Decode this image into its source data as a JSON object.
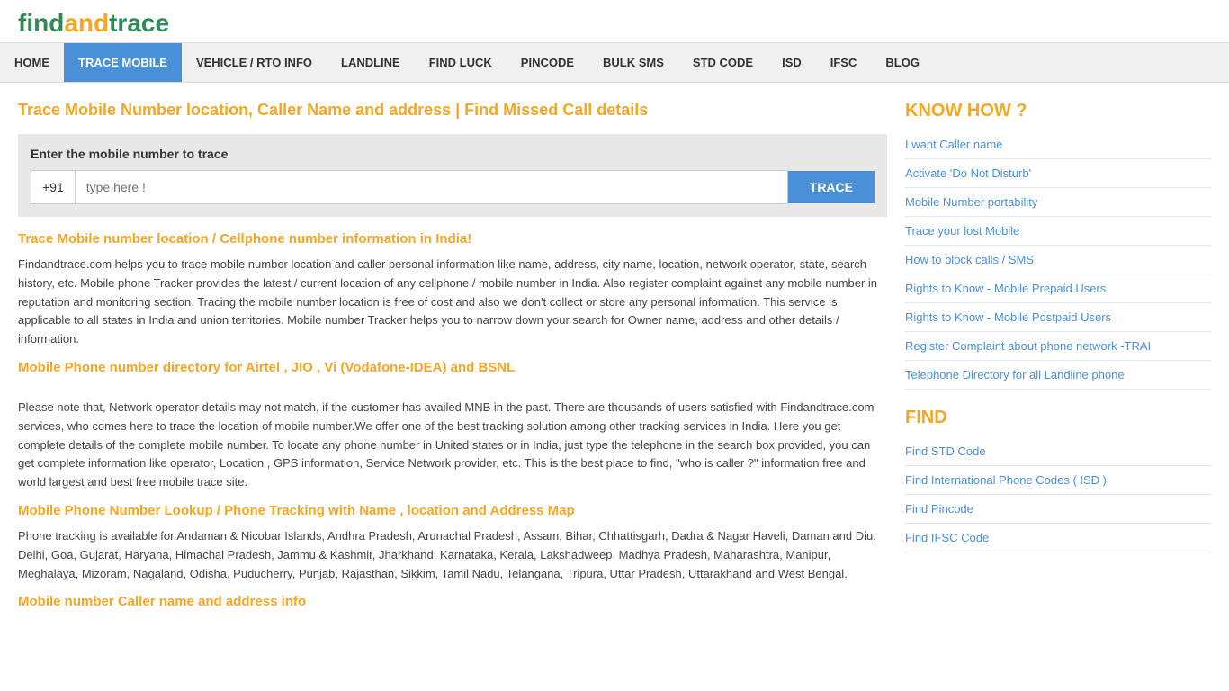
{
  "logo": {
    "find": "find",
    "and": "and",
    "trace": "trace"
  },
  "nav": {
    "items": [
      {
        "label": "HOME",
        "active": false
      },
      {
        "label": "TRACE MOBILE",
        "active": true
      },
      {
        "label": "VEHICLE / RTO INFO",
        "active": false
      },
      {
        "label": "LANDLINE",
        "active": false
      },
      {
        "label": "FIND LUCK",
        "active": false
      },
      {
        "label": "PINCODE",
        "active": false
      },
      {
        "label": "BULK SMS",
        "active": false
      },
      {
        "label": "STD CODE",
        "active": false
      },
      {
        "label": "ISD",
        "active": false
      },
      {
        "label": "IFSC",
        "active": false
      },
      {
        "label": "BLOG",
        "active": false
      }
    ]
  },
  "page": {
    "title": "Trace Mobile Number location, Caller Name and address | Find Missed Call details",
    "search": {
      "label": "Enter the mobile number to trace",
      "country_code": "+91",
      "placeholder": "type here !",
      "button_label": "TRACE"
    },
    "section1_heading": "Trace Mobile number location / Cellphone number information in India!",
    "section1_text": "Findandtrace.com helps you to trace mobile number location and caller personal information like name, address, city name, location, network operator, state, search history, etc. Mobile phone Tracker provides the latest / current location of any cellphone / mobile number in India. Also register complaint against any mobile number in reputation and monitoring section. Tracing the mobile number location is free of cost and also we don't collect or store any personal information. This service is applicable to all states in India and union territories. Mobile number Tracker helps you to narrow down your search for Owner name, address and other details / information.",
    "section1_link": "Mobile Phone number directory for Airtel , JIO , Vi (Vodafone-IDEA) and BSNL",
    "section2_text": "Please note that, Network operator details may not match, if the customer has availed MNB in the past. There are thousands of users satisfied with Findandtrace.com services, who comes here to trace the location of mobile number.We offer one of the best tracking solution among other tracking services in India. Here you get complete details of the complete mobile number. To locate any phone number in United states or in India, just type the telephone in the search box provided, you can get complete information like operator, Location , GPS information, Service Network provider, etc. This is the best place to find, \"who is caller ?\" information free and world largest and best free mobile trace site.",
    "section3_heading": "Mobile Phone Number Lookup / Phone Tracking with Name , location and Address Map",
    "section3_text": "Phone tracking is available for Andaman & Nicobar Islands, Andhra Pradesh, Arunachal Pradesh, Assam, Bihar, Chhattisgarh, Dadra & Nagar Haveli, Daman and Diu, Delhi, Goa, Gujarat, Haryana, Himachal Pradesh, Jammu & Kashmir, Jharkhand, Karnataka, Kerala, Lakshadweep, Madhya Pradesh, Maharashtra, Manipur, Meghalaya, Mizoram, Nagaland, Odisha, Puducherry, Punjab, Rajasthan, Sikkim, Tamil Nadu, Telangana, Tripura, Uttar Pradesh, Uttarakhand and West Bengal.",
    "section4_heading": "Mobile number Caller name and address info"
  },
  "sidebar": {
    "know_how_title": "KNOW HOW ?",
    "know_how_links": [
      "I want Caller name",
      "Activate 'Do Not Disturb'",
      "Mobile Number portability",
      "Trace your lost Mobile",
      "How to block calls / SMS",
      "Rights to Know - Mobile Prepaid Users",
      "Rights to Know - Mobile Postpaid Users",
      "Register Complaint about phone network -TRAI",
      "Telephone Directory for all Landline phone"
    ],
    "find_title": "FIND",
    "find_links": [
      "Find STD Code",
      "Find International Phone Codes ( ISD )",
      "Find Pincode",
      "Find IFSC Code"
    ]
  }
}
